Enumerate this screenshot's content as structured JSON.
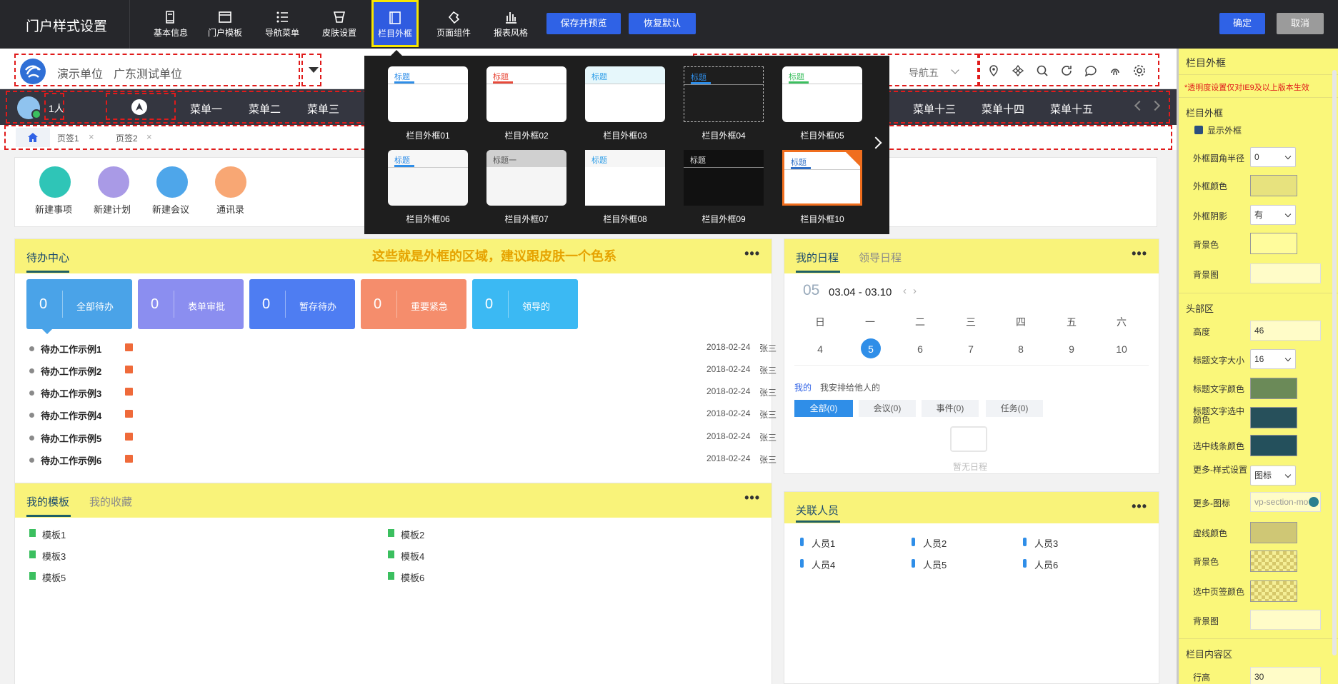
{
  "topbar": {
    "title": "门户样式设置",
    "tools": [
      {
        "label": "基本信息",
        "icon": "book-icon"
      },
      {
        "label": "门户模板",
        "icon": "window-icon"
      },
      {
        "label": "导航菜单",
        "icon": "list-icon"
      },
      {
        "label": "皮肤设置",
        "icon": "shirt-icon"
      },
      {
        "label": "栏目外框",
        "icon": "frame-icon",
        "active": true
      },
      {
        "label": "页面组件",
        "icon": "puzzle-icon"
      },
      {
        "label": "报表风格",
        "icon": "bar-chart-icon"
      }
    ],
    "save_preview": "保存并预览",
    "restore_default": "恢复默认",
    "confirm": "确定",
    "cancel": "取消"
  },
  "header": {
    "unit1": "演示单位",
    "unit2": "广东测试单位",
    "nav_right": "导航五"
  },
  "nav": {
    "user_count": "1人",
    "items": [
      "菜单一",
      "菜单二",
      "菜单三"
    ],
    "items_right": [
      "菜单十三",
      "菜单十四",
      "菜单十五"
    ]
  },
  "tabs": [
    "页签1",
    "页签2"
  ],
  "shortcuts": [
    "新建事项",
    "新建计划",
    "新建会议",
    "通讯录"
  ],
  "annotation": "这些就是外框的区域，建议跟皮肤一个色系",
  "todo": {
    "title": "待办中心",
    "tiles": [
      {
        "count": "0",
        "label": "全部待办",
        "color": "#4aa3e8"
      },
      {
        "count": "0",
        "label": "表单审批",
        "color": "#8b8ef0"
      },
      {
        "count": "0",
        "label": "暂存待办",
        "color": "#4e7df2"
      },
      {
        "count": "0",
        "label": "重要紧急",
        "color": "#f58d6c"
      },
      {
        "count": "0",
        "label": "领导的",
        "color": "#3bb9f3"
      }
    ],
    "rows": [
      {
        "title": "待办工作示例1",
        "date": "2018-02-24",
        "who": "张三"
      },
      {
        "title": "待办工作示例2",
        "date": "2018-02-24",
        "who": "张三"
      },
      {
        "title": "待办工作示例3",
        "date": "2018-02-24",
        "who": "张三"
      },
      {
        "title": "待办工作示例4",
        "date": "2018-02-24",
        "who": "张三"
      },
      {
        "title": "待办工作示例5",
        "date": "2018-02-24",
        "who": "张三"
      },
      {
        "title": "待办工作示例6",
        "date": "2018-02-24",
        "who": "张三"
      }
    ]
  },
  "schedule": {
    "tab1": "我的日程",
    "tab2": "领导日程",
    "month": "05",
    "range": "03.04 - 03.10",
    "weekdays": [
      "日",
      "一",
      "二",
      "三",
      "四",
      "五",
      "六"
    ],
    "days": [
      "4",
      "5",
      "6",
      "7",
      "8",
      "9",
      "10"
    ],
    "mine": "我的",
    "assigned": "我安排给他人的",
    "filters": [
      "全部(0)",
      "会议(0)",
      "事件(0)",
      "任务(0)"
    ],
    "empty": "暂无日程"
  },
  "templates": {
    "tab1": "我的模板",
    "tab2": "我的收藏",
    "items": [
      "模板1",
      "模板2",
      "模板3",
      "模板4",
      "模板5",
      "模板6"
    ]
  },
  "people": {
    "title": "关联人员",
    "items": [
      "人员1",
      "人员2",
      "人员3",
      "人员4",
      "人员5",
      "人员6"
    ]
  },
  "popup": {
    "frames": [
      "栏目外框01",
      "栏目外框02",
      "栏目外框03",
      "栏目外框04",
      "栏目外框05",
      "栏目外框06",
      "栏目外框07",
      "栏目外框08",
      "栏目外框09",
      "栏目外框10"
    ],
    "thumb_titles": [
      "标题",
      "标题",
      "标题",
      "标题",
      "标题",
      "标题",
      "标题一",
      "标题",
      "标题",
      "标题"
    ]
  },
  "panel": {
    "title": "栏目外框",
    "note": "*透明度设置仅对IE9及以上版本生效",
    "sec1": "栏目外框",
    "show_frame": "显示外框",
    "radius_label": "外框圆角半径",
    "radius_value": "0",
    "frame_color_label": "外框颜色",
    "shadow_label": "外框阴影",
    "shadow_value": "有",
    "bg_color_label": "背景色",
    "bg_img_label": "背景图",
    "sec2": "头部区",
    "height_label": "高度",
    "height_value": "46",
    "font_size_label": "标题文字大小",
    "font_size_value": "16",
    "font_color_label": "标题文字颜色",
    "font_sel_color_label": "标题文字选中颜色",
    "line_color_label": "选中线条颜色",
    "more_style_label": "更多-样式设置",
    "more_style_value": "图标",
    "more_icon_label": "更多-图标",
    "more_icon_value": "vp-section-mo",
    "dash_color_label": "虚线颜色",
    "bg_color2_label": "背景色",
    "tab_color_label": "选中页签颜色",
    "bg_img2_label": "背景图",
    "sec3": "栏目内容区",
    "row_height_label": "行高",
    "row_height_value": "30"
  }
}
